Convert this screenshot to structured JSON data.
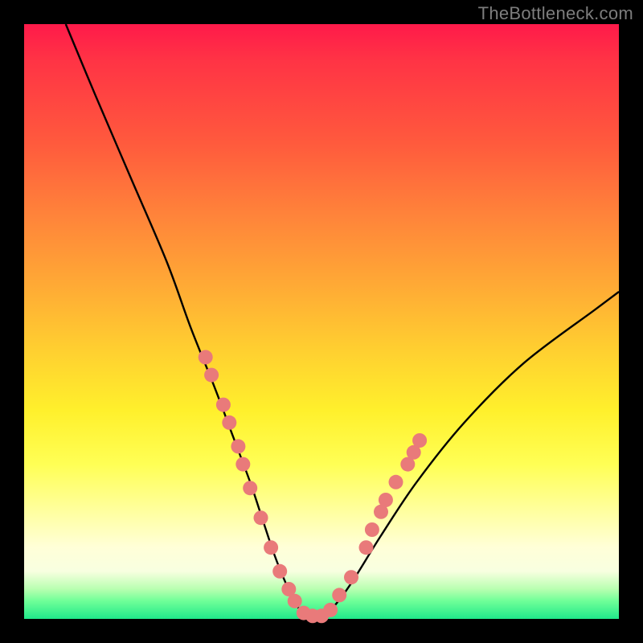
{
  "watermark": "TheBottleneck.com",
  "chart_data": {
    "type": "line",
    "title": "",
    "xlabel": "",
    "ylabel": "",
    "xlim": [
      0,
      100
    ],
    "ylim": [
      0,
      100
    ],
    "series": [
      {
        "name": "curve",
        "x": [
          7,
          12,
          18,
          24,
          28,
          32,
          35,
          38,
          40,
          42,
          44,
          46,
          48,
          50,
          52,
          55,
          60,
          66,
          74,
          84,
          96,
          100
        ],
        "y": [
          100,
          88,
          74,
          60,
          49,
          39,
          31,
          23,
          17,
          11,
          6,
          2,
          0.5,
          0.5,
          2,
          6,
          14,
          23,
          33,
          43,
          52,
          55
        ],
        "color": "#000000"
      }
    ],
    "markers": [
      {
        "x": 30.5,
        "y": 44
      },
      {
        "x": 31.5,
        "y": 41
      },
      {
        "x": 33.5,
        "y": 36
      },
      {
        "x": 34.5,
        "y": 33
      },
      {
        "x": 36.0,
        "y": 29
      },
      {
        "x": 36.8,
        "y": 26
      },
      {
        "x": 38.0,
        "y": 22
      },
      {
        "x": 39.8,
        "y": 17
      },
      {
        "x": 41.5,
        "y": 12
      },
      {
        "x": 43.0,
        "y": 8
      },
      {
        "x": 44.5,
        "y": 5
      },
      {
        "x": 45.5,
        "y": 3
      },
      {
        "x": 47.0,
        "y": 1
      },
      {
        "x": 48.5,
        "y": 0.5
      },
      {
        "x": 50.0,
        "y": 0.5
      },
      {
        "x": 51.5,
        "y": 1.5
      },
      {
        "x": 53.0,
        "y": 4
      },
      {
        "x": 55.0,
        "y": 7
      },
      {
        "x": 57.5,
        "y": 12
      },
      {
        "x": 58.5,
        "y": 15
      },
      {
        "x": 60.0,
        "y": 18
      },
      {
        "x": 60.8,
        "y": 20
      },
      {
        "x": 62.5,
        "y": 23
      },
      {
        "x": 64.5,
        "y": 26
      },
      {
        "x": 65.5,
        "y": 28
      },
      {
        "x": 66.5,
        "y": 30
      }
    ],
    "marker_color": "#e97a7a",
    "marker_radius": 9
  }
}
